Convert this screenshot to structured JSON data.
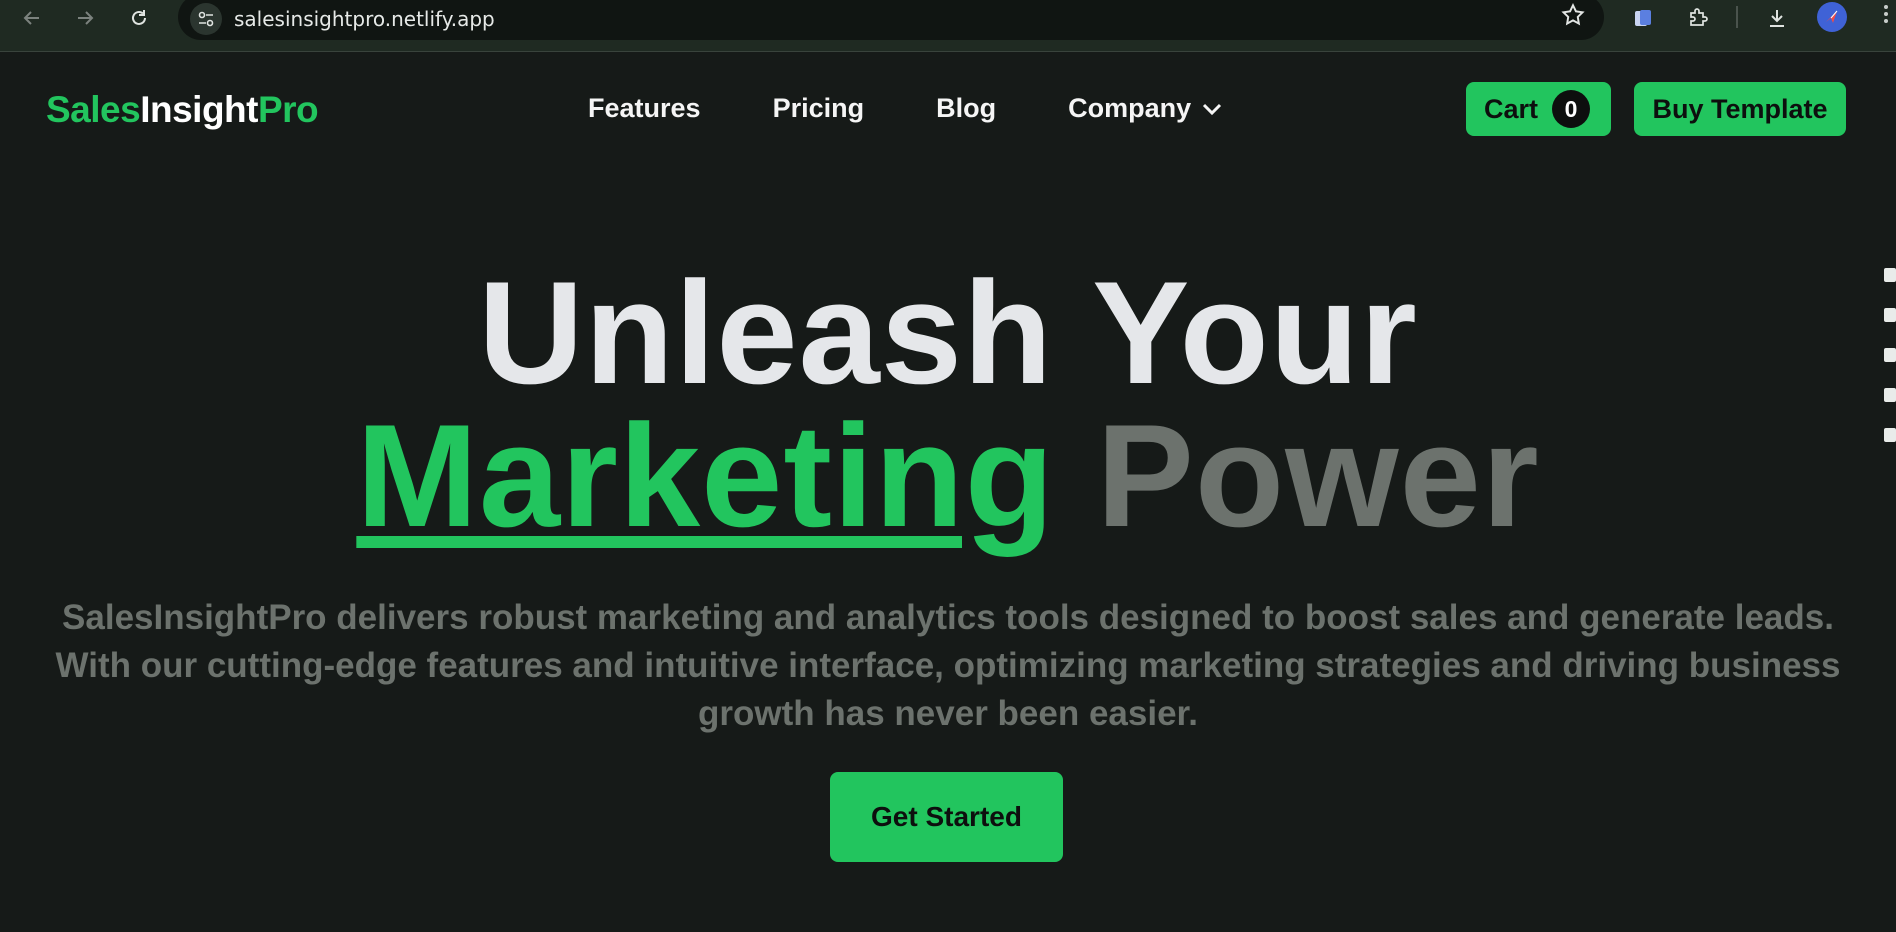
{
  "browser": {
    "url": "salesinsightpro.netlify.app",
    "icons": [
      "back-arrow-icon",
      "forward-arrow-icon",
      "reload-icon",
      "site-settings-icon",
      "bookmark-star-icon",
      "sidebar-extension-icon",
      "extensions-puzzle-icon",
      "download-icon",
      "profile-avatar-icon",
      "more-menu-icon"
    ]
  },
  "header": {
    "logo": {
      "part1": "Sales",
      "part2": "Insight",
      "part3": "Pro"
    },
    "nav": [
      {
        "label": "Features"
      },
      {
        "label": "Pricing"
      },
      {
        "label": "Blog"
      },
      {
        "label": "Company"
      }
    ],
    "cart": {
      "label": "Cart",
      "count": "0"
    },
    "buy_template": "Buy Template"
  },
  "hero": {
    "line1": "Unleash Your",
    "highlight": "Marketing",
    "line2_rest": "Power",
    "description": "SalesInsightPro delivers robust marketing and analytics tools designed to boost sales and generate leads. With our cutting-edge features and intuitive interface, optimizing marketing strategies and driving business growth has never been easier.",
    "cta": "Get Started"
  },
  "colors": {
    "background": "#161a18",
    "accent": "#22c55e",
    "heading_light": "#e5e7ea",
    "muted_text": "#6c726d"
  }
}
